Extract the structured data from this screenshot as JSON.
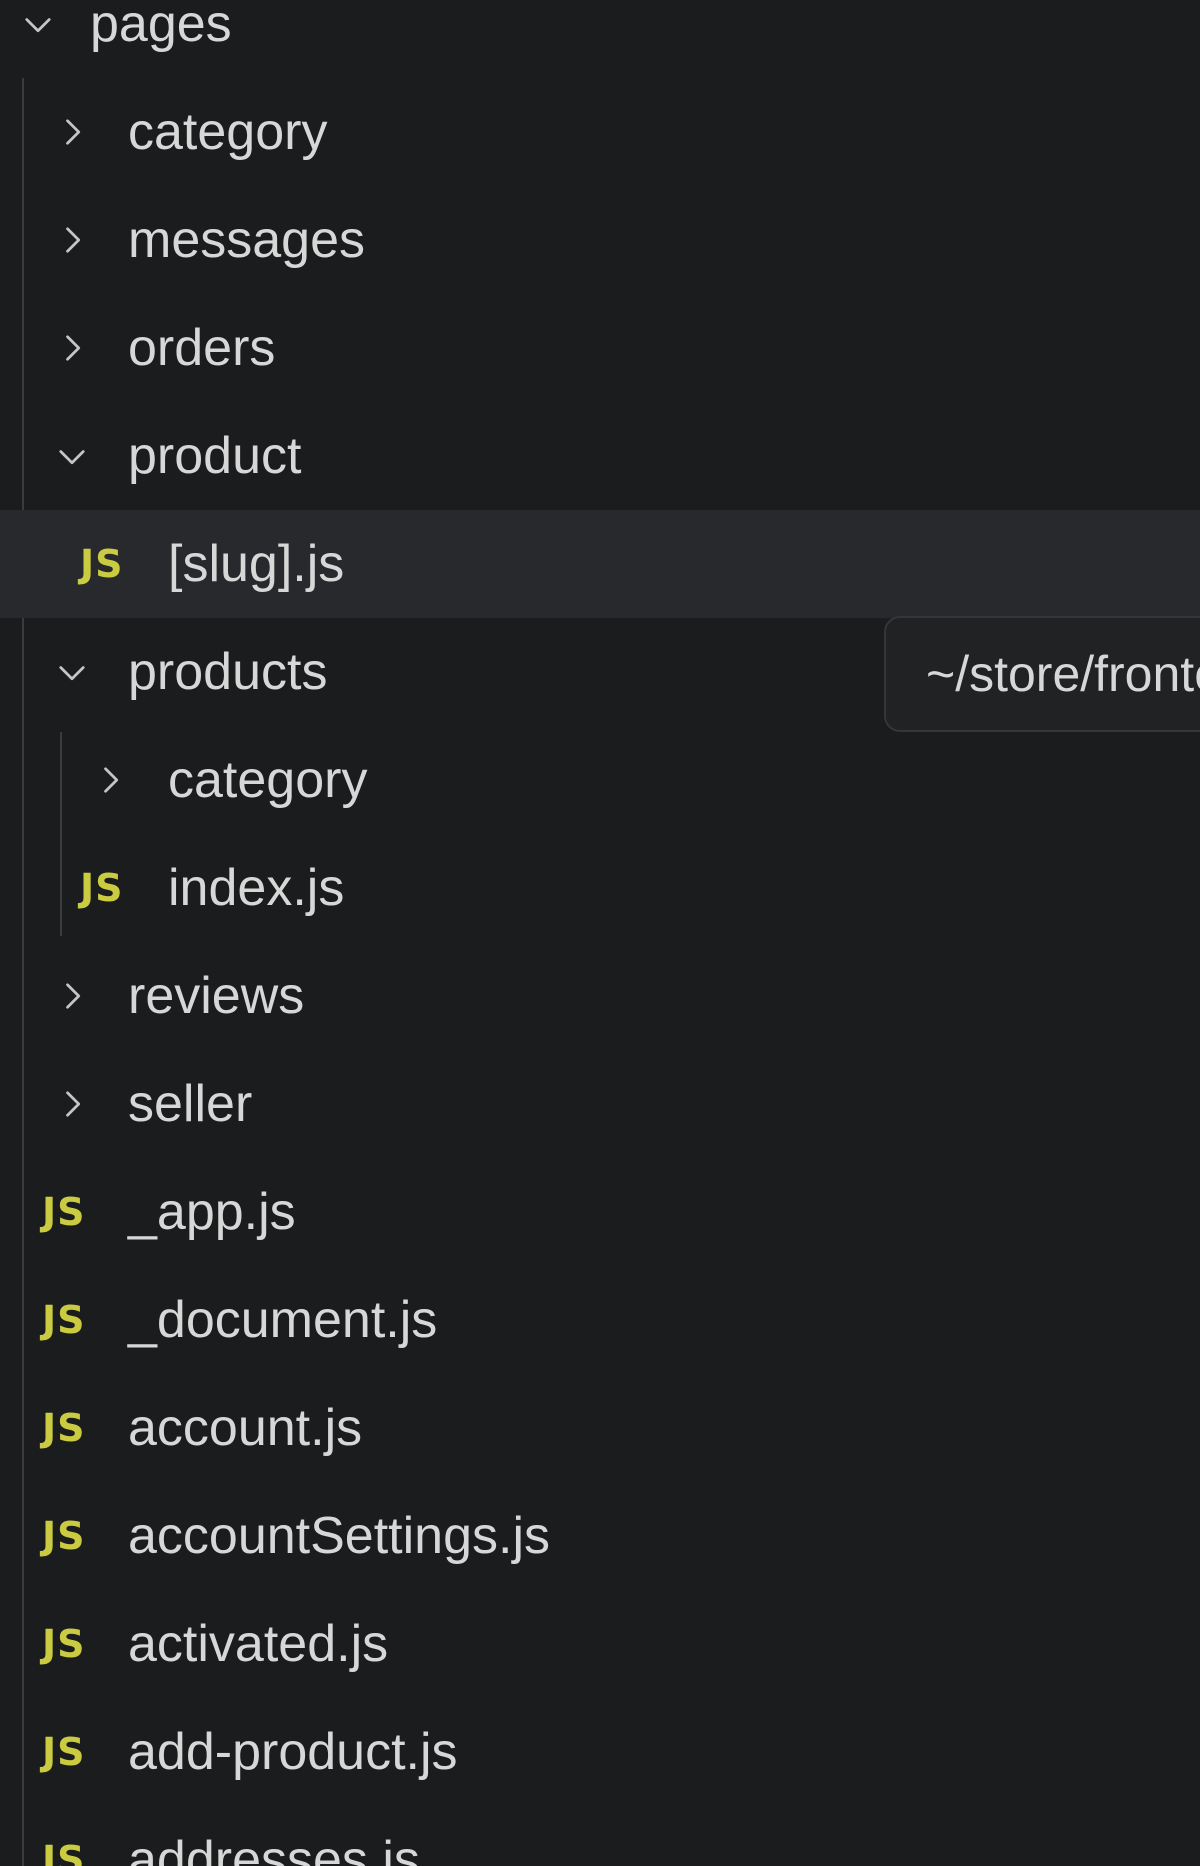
{
  "explorer": {
    "root": {
      "label": "pages",
      "state": "expanded"
    },
    "items": [
      {
        "label": "category",
        "type": "folder",
        "state": "collapsed",
        "depth": 1
      },
      {
        "label": "messages",
        "type": "folder",
        "state": "collapsed",
        "depth": 1
      },
      {
        "label": "orders",
        "type": "folder",
        "state": "collapsed",
        "depth": 1
      },
      {
        "label": "product",
        "type": "folder",
        "state": "expanded",
        "depth": 1
      },
      {
        "label": "[slug].js",
        "type": "file",
        "icon": "JS",
        "depth": 2,
        "selected": true
      },
      {
        "label": "products",
        "type": "folder",
        "state": "expanded",
        "depth": 1
      },
      {
        "label": "category",
        "type": "folder",
        "state": "collapsed",
        "depth": 2
      },
      {
        "label": "index.js",
        "type": "file",
        "icon": "JS",
        "depth": 2
      },
      {
        "label": "reviews",
        "type": "folder",
        "state": "collapsed",
        "depth": 1
      },
      {
        "label": "seller",
        "type": "folder",
        "state": "collapsed",
        "depth": 1
      },
      {
        "label": "_app.js",
        "type": "file",
        "icon": "JS",
        "depth": 1
      },
      {
        "label": "_document.js",
        "type": "file",
        "icon": "JS",
        "depth": 1
      },
      {
        "label": "account.js",
        "type": "file",
        "icon": "JS",
        "depth": 1
      },
      {
        "label": "accountSettings.js",
        "type": "file",
        "icon": "JS",
        "depth": 1
      },
      {
        "label": "activated.js",
        "type": "file",
        "icon": "JS",
        "depth": 1
      },
      {
        "label": "add-product.js",
        "type": "file",
        "icon": "JS",
        "depth": 1
      },
      {
        "label": "addresses.js",
        "type": "file",
        "icon": "JS",
        "depth": 1
      }
    ]
  },
  "tooltip": {
    "text": "~/store/frontend/pages/product/[slug].js"
  },
  "colors": {
    "background": "#1b1c1d",
    "selected_row": "#27292c",
    "text": "#d7d7d7",
    "js_icon": "#cbcb41",
    "chevron": "#c5c5c5",
    "indent_guide": "#3a3c3e"
  }
}
